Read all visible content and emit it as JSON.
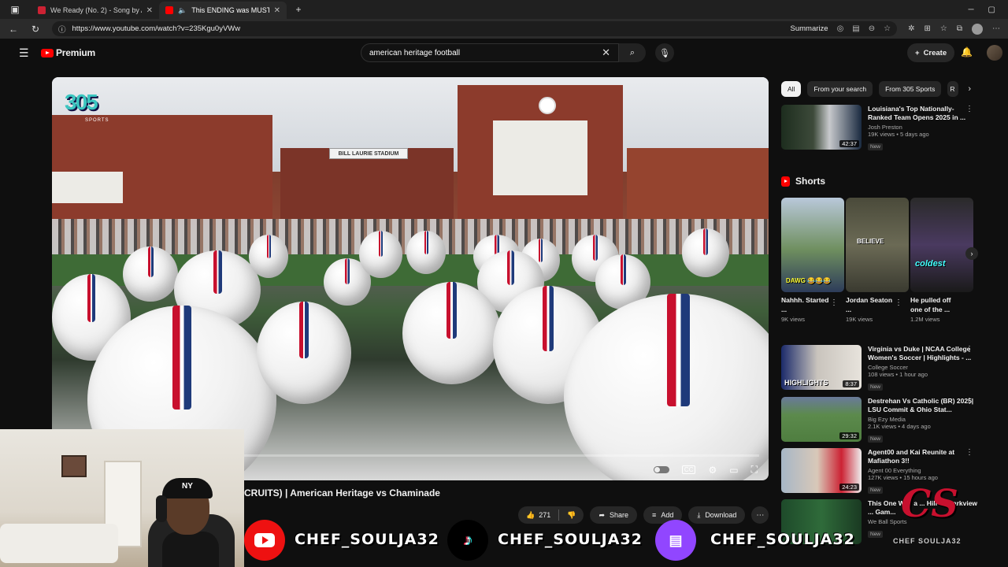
{
  "browser": {
    "tabs": [
      {
        "title": "We Ready (No. 2) - Song by Arch",
        "active": false
      },
      {
        "title": "This ENDING was MUST WA",
        "active": true
      }
    ],
    "url": "https://www.youtube.com/watch?v=235Kgu0yVWw",
    "summarize_label": "Summarize"
  },
  "header": {
    "brand": "Premium",
    "search_value": "american heritage football",
    "create_label": "Create"
  },
  "video": {
    "channel_watermark_num": "305",
    "channel_watermark_sub": "SPORTS",
    "stadium_sign": "BILL LAURIE STADIUM",
    "progress": 0.0,
    "title": "CRUITS) | American Heritage vs Chaminade",
    "like_count": "271",
    "share_label": "Share",
    "add_label": "Add",
    "download_label": "Download"
  },
  "sidebar": {
    "chips": [
      "All",
      "From your search",
      "From 305 Sports",
      "R"
    ],
    "top_rec": {
      "title": "Louisiana's Top Nationally-Ranked Team Opens 2025 in ...",
      "channel": "Josh Preston",
      "stats": "19K views • 5 days ago",
      "badge": "New",
      "duration": "42:37"
    },
    "shorts_heading": "Shorts",
    "shorts": [
      {
        "title": "Nahhh. Started ...",
        "views": "9K views",
        "overlay": "DAWG 😂😂😂"
      },
      {
        "title": "Jordan Seaton ...",
        "views": "19K views",
        "overlay": "BELIEVE"
      },
      {
        "title": "He pulled off one of the ...",
        "views": "1.2M views",
        "overlay": "coldest"
      }
    ],
    "recs": [
      {
        "title": "Virginia vs Duke | NCAA College Women's Soccer | Highlights - ...",
        "channel": "College Soccer",
        "stats": "108 views • 1 hour ago",
        "badge": "New",
        "duration": "8:37",
        "thumb_text": "HIGHLIGHTS"
      },
      {
        "title": "Destrehan Vs Catholic (BR) 2025| LSU Commit & Ohio Stat...",
        "channel": "Big Ezy Media",
        "stats": "2.1K views • 4 days ago",
        "badge": "New",
        "duration": "29:32",
        "thumb_text": ""
      },
      {
        "title": "Agent00 and Kai Reunite at Mafiathon 3!!",
        "channel": "Agent 00 Everything",
        "stats": "127K views • 15 hours ago",
        "badge": "New",
        "duration": "24:23",
        "thumb_text": ""
      },
      {
        "title": "This One Was a ... Hill vs Parkview ... Gam...",
        "channel": "We Ball Sports",
        "stats": "",
        "badge": "New",
        "duration": "",
        "thumb_text": ""
      }
    ]
  },
  "overlay": {
    "handle": "CHEF_SOULJA32",
    "brand_initials": "CS",
    "brand_under": "CHEF SOULJA32"
  },
  "colors": {
    "youtube_red": "#ff0000",
    "tiktok_cyan": "#25f4ee",
    "twitch_purple": "#9146ff"
  }
}
